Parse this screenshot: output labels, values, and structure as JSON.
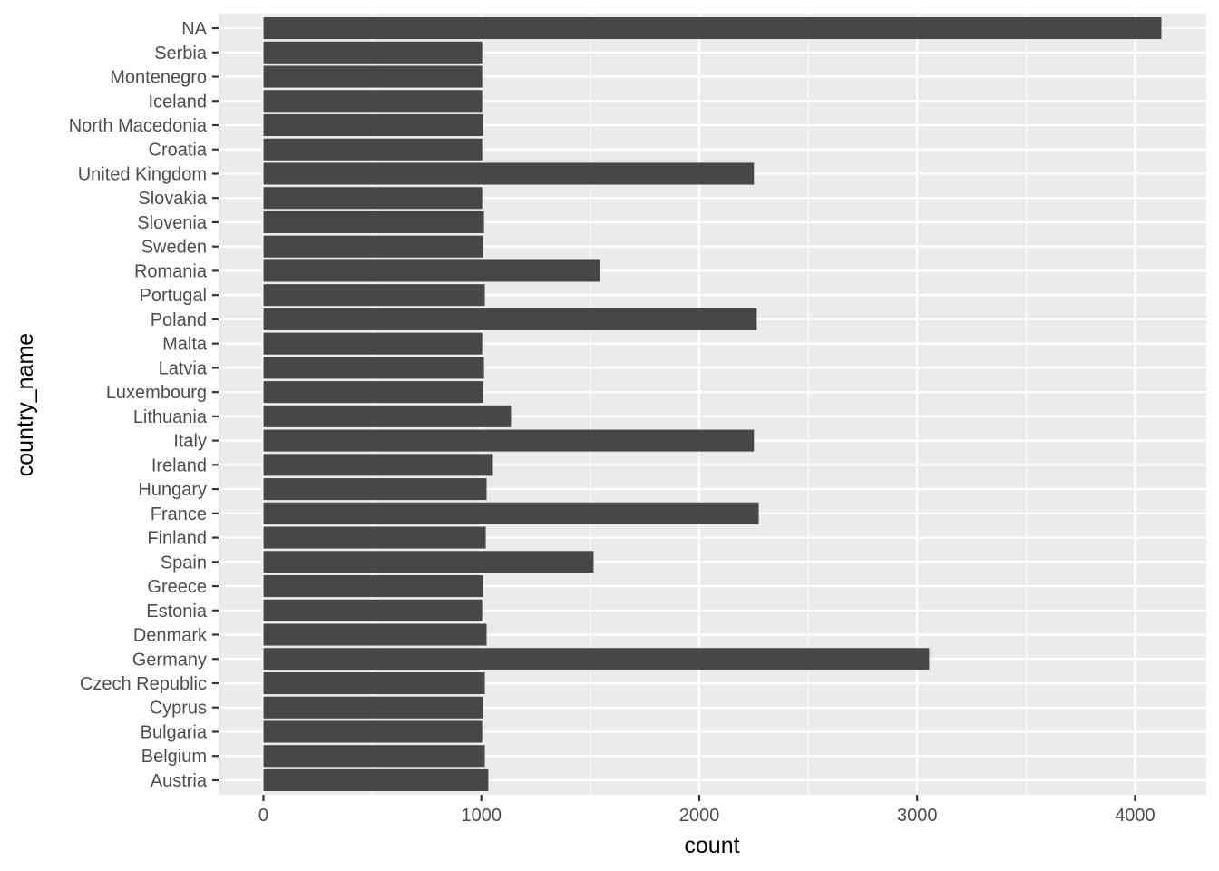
{
  "chart_data": {
    "type": "bar",
    "orientation": "horizontal",
    "title": "",
    "xlabel": "count",
    "ylabel": "country_name",
    "xlim": [
      -206,
      4327
    ],
    "x_ticks": [
      0,
      1000,
      2000,
      3000,
      4000
    ],
    "x_tick_labels": [
      "0",
      "1000",
      "2000",
      "3000",
      "4000"
    ],
    "grid": true,
    "legend": "none",
    "categories": [
      "NA",
      "Serbia",
      "Montenegro",
      "Iceland",
      "North Macedonia",
      "Croatia",
      "United Kingdom",
      "Slovakia",
      "Slovenia",
      "Sweden",
      "Romania",
      "Portugal",
      "Poland",
      "Malta",
      "Latvia",
      "Luxembourg",
      "Lithuania",
      "Italy",
      "Ireland",
      "Hungary",
      "France",
      "Finland",
      "Spain",
      "Greece",
      "Estonia",
      "Denmark",
      "Germany",
      "Czech Republic",
      "Cyprus",
      "Bulgaria",
      "Belgium",
      "Austria"
    ],
    "values": [
      4121,
      1004,
      1004,
      1004,
      1008,
      1004,
      2251,
      1004,
      1012,
      1008,
      1544,
      1016,
      2264,
      1004,
      1012,
      1008,
      1136,
      2251,
      1053,
      1024,
      2273,
      1020,
      1515,
      1008,
      1004,
      1024,
      3055,
      1016,
      1008,
      1004,
      1016,
      1032
    ],
    "colors": {
      "bar": "#474747",
      "panel": "#EBEBEB",
      "grid": "#FFFFFF",
      "tick_text": "#4D4D4D",
      "title_text": "#000000"
    }
  }
}
